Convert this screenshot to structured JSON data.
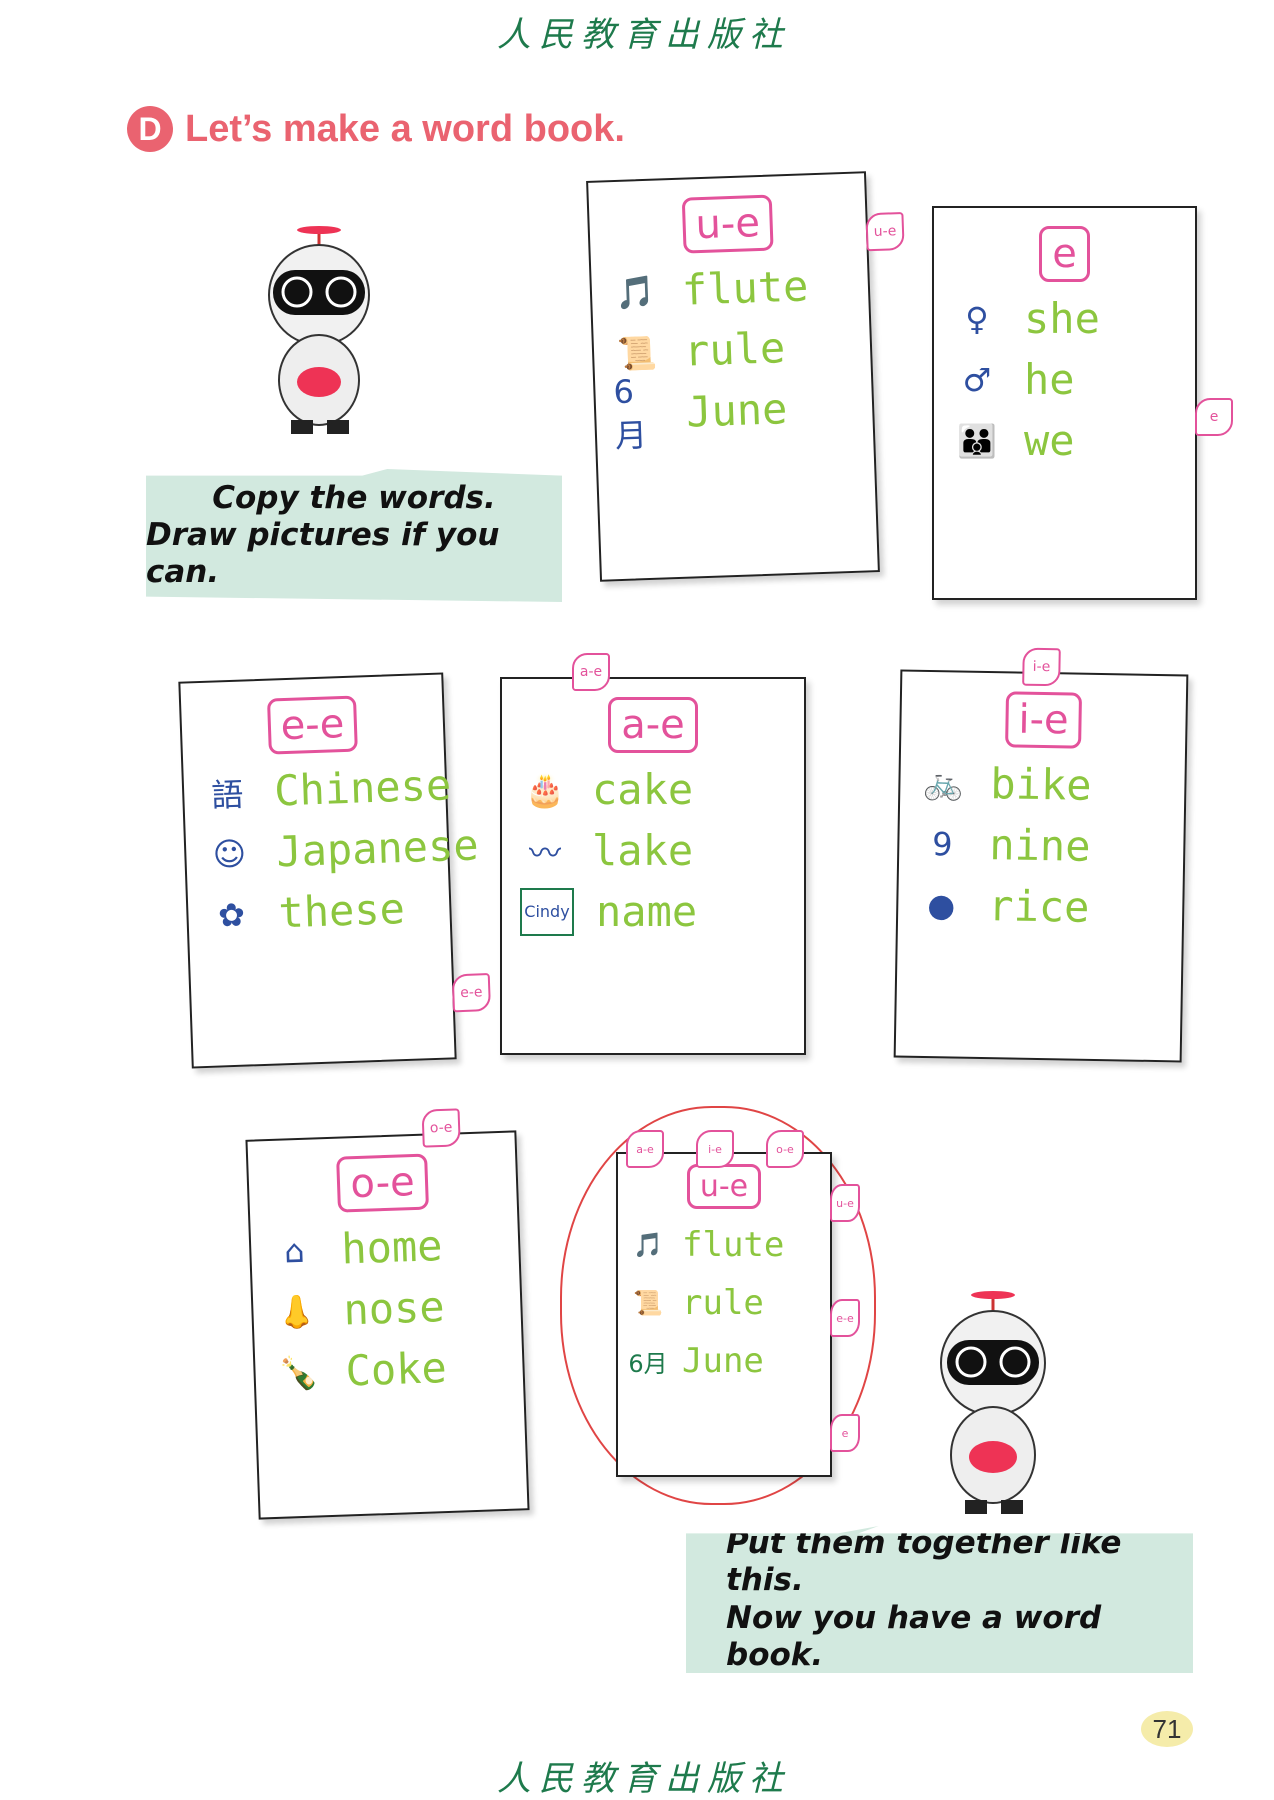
{
  "publisher": "人民教育出版社",
  "section": {
    "letter": "D",
    "title": "Let’s make a word book."
  },
  "bubble_top": {
    "line1": "Copy the words.",
    "line2": "Draw pictures if you can."
  },
  "bubble_bottom": {
    "line1": "Put them together like this.",
    "line2": "Now you have a word book."
  },
  "page_number": "71",
  "cards": [
    {
      "header": "u-e",
      "tab": "u-e",
      "rows": [
        {
          "icon": "flute-icon",
          "glyph": "🎵",
          "word": "flute"
        },
        {
          "icon": "rule-paper-icon",
          "glyph": "📜",
          "word": "rule"
        },
        {
          "icon": "june-calendar-icon",
          "glyph": "6月",
          "word": "June"
        }
      ]
    },
    {
      "header": "e",
      "tab": "e",
      "rows": [
        {
          "icon": "girl-icon",
          "glyph": "♀",
          "word": "she"
        },
        {
          "icon": "boy-icon",
          "glyph": "♂",
          "word": "he"
        },
        {
          "icon": "group-icon",
          "glyph": "👪",
          "word": "we"
        }
      ]
    },
    {
      "header": "e-e",
      "tab": "e-e",
      "rows": [
        {
          "icon": "chinese-book-icon",
          "glyph": "語",
          "word": "Chinese"
        },
        {
          "icon": "japanese-girl-icon",
          "glyph": "☺",
          "word": "Japanese"
        },
        {
          "icon": "flowers-icon",
          "glyph": "✿",
          "word": "these"
        }
      ]
    },
    {
      "header": "a-e",
      "tab": "a-e",
      "rows": [
        {
          "icon": "cake-icon",
          "glyph": "🎂",
          "word": "cake"
        },
        {
          "icon": "lake-icon",
          "glyph": "〰",
          "word": "lake"
        },
        {
          "icon": "name-tag-icon",
          "glyph": "Cindy",
          "word": "name"
        }
      ]
    },
    {
      "header": "i-e",
      "tab": "i-e",
      "rows": [
        {
          "icon": "bike-icon",
          "glyph": "🚲",
          "word": "bike"
        },
        {
          "icon": "nine-icon",
          "glyph": "9",
          "word": "nine"
        },
        {
          "icon": "rice-bowl-icon",
          "glyph": "●",
          "word": "rice"
        }
      ]
    },
    {
      "header": "o-e",
      "tab": "o-e",
      "rows": [
        {
          "icon": "house-icon",
          "glyph": "⌂",
          "word": "home"
        },
        {
          "icon": "nose-icon",
          "glyph": "👃",
          "word": "nose"
        },
        {
          "icon": "coke-bottle-icon",
          "glyph": "🍾",
          "word": "Coke"
        }
      ]
    }
  ],
  "combined": {
    "header": "u-e",
    "tabs": [
      "a-e",
      "i-e",
      "o-e"
    ],
    "side_tabs": [
      "u-e",
      "e-e",
      "e"
    ],
    "rows": [
      {
        "glyph": "🎵",
        "word": "flute"
      },
      {
        "glyph": "📜",
        "word": "rule"
      },
      {
        "glyph": "6月",
        "word": "June"
      }
    ]
  },
  "colors": {
    "accent": "#ea6370",
    "pink": "#e3529b",
    "green_word": "#8cc63f",
    "bubble": "#d2e9df",
    "logo": "#1e7a4c"
  }
}
